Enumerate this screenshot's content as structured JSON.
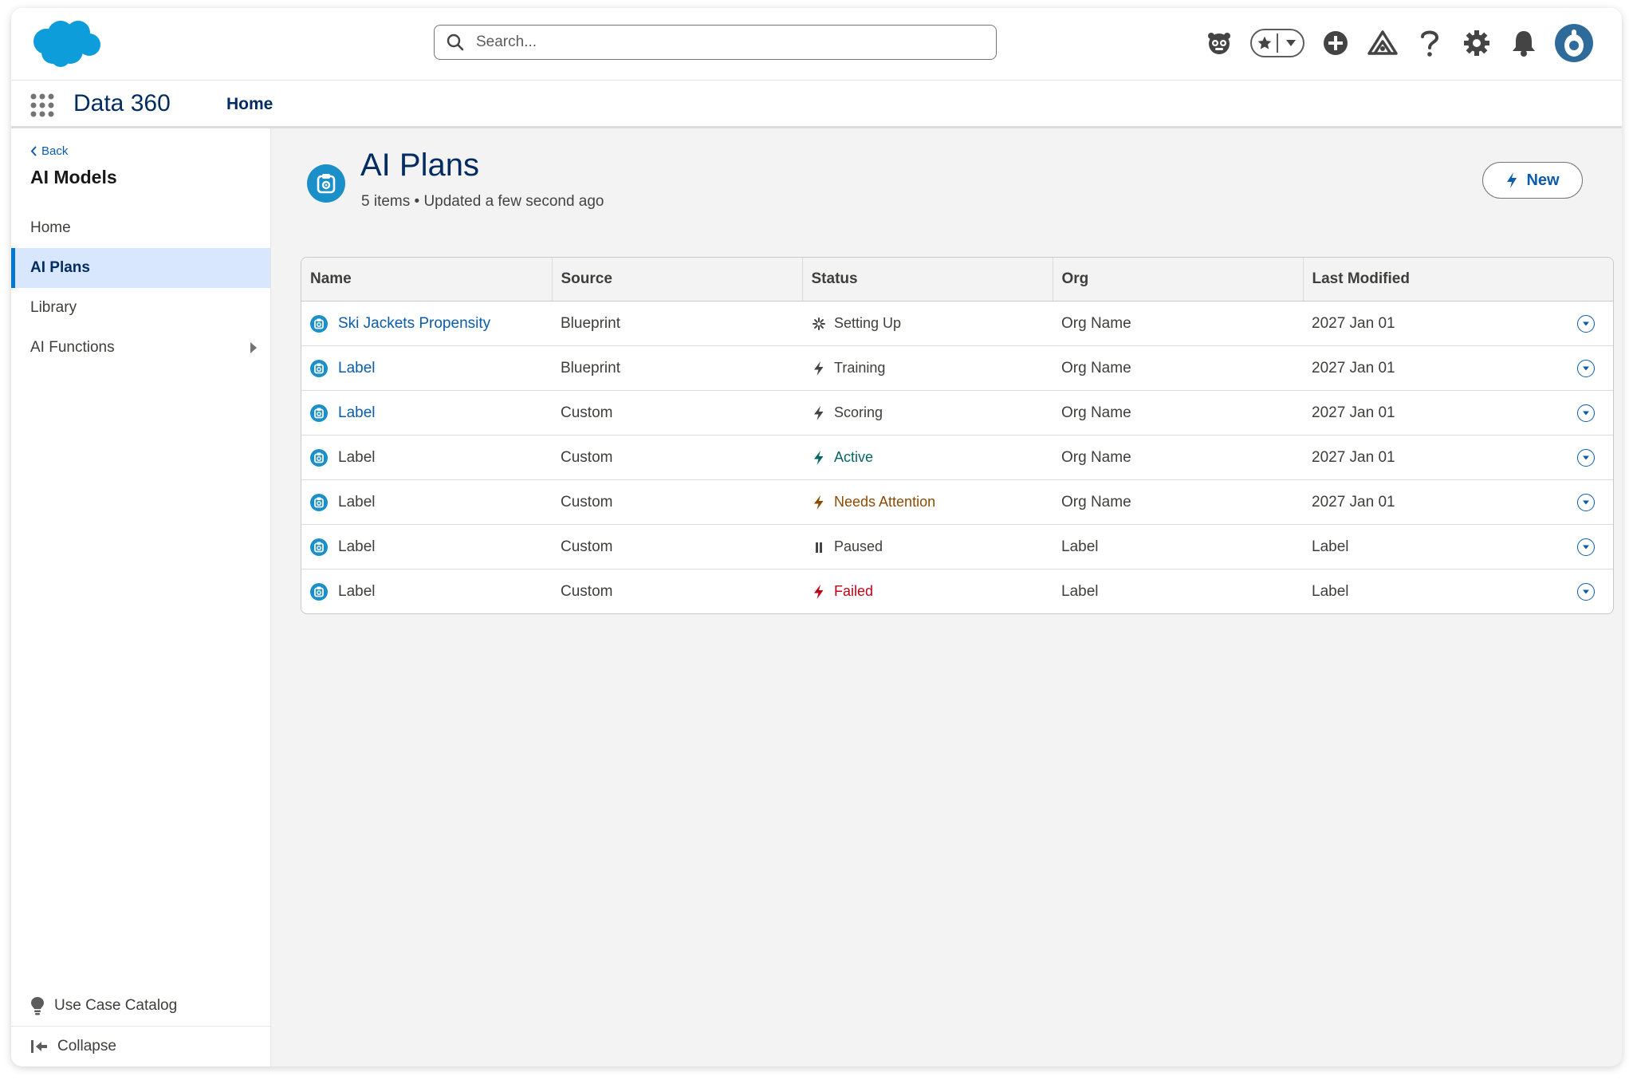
{
  "header": {
    "search_placeholder": "Search...",
    "icons": [
      "einstein-icon",
      "favorites-star-icon",
      "favorites-dropdown-icon",
      "global-add-icon",
      "trailhead-icon",
      "help-icon",
      "setup-gear-icon",
      "notifications-bell-icon",
      "user-avatar"
    ]
  },
  "context": {
    "app_name": "Data 360",
    "nav_item": "Home"
  },
  "sidebar": {
    "back_label": "Back",
    "title": "AI Models",
    "items": [
      {
        "label": "Home",
        "active": false
      },
      {
        "label": "AI Plans",
        "active": true
      },
      {
        "label": "Library",
        "active": false
      },
      {
        "label": "AI Functions",
        "active": false,
        "has_submenu": true
      }
    ],
    "footer": {
      "catalog_label": "Use Case Catalog",
      "collapse_label": "Collapse"
    }
  },
  "main": {
    "title": "AI Plans",
    "subtitle": "5 items • Updated a few second ago",
    "new_button": "New",
    "table": {
      "columns": [
        "Name",
        "Source",
        "Status",
        "Org",
        "Last Modified"
      ],
      "rows": [
        {
          "name": "Ski Jackets Propensity",
          "name_link": true,
          "source": "Blueprint",
          "status": "Setting Up",
          "status_icon": "spinner-icon",
          "status_tone": "default",
          "org": "Org Name",
          "modified": "2027 Jan 01"
        },
        {
          "name": "Label",
          "name_link": true,
          "source": "Blueprint",
          "status": "Training",
          "status_icon": "bolt-icon",
          "status_tone": "default",
          "org": "Org Name",
          "modified": "2027 Jan 01"
        },
        {
          "name": "Label",
          "name_link": true,
          "source": "Custom",
          "status": "Scoring",
          "status_icon": "bolt-icon",
          "status_tone": "default",
          "org": "Org Name",
          "modified": "2027 Jan 01"
        },
        {
          "name": "Label",
          "name_link": false,
          "source": "Custom",
          "status": "Active",
          "status_icon": "bolt-icon",
          "status_tone": "success",
          "org": "Org Name",
          "modified": "2027 Jan 01"
        },
        {
          "name": "Label",
          "name_link": false,
          "source": "Custom",
          "status": "Needs Attention",
          "status_icon": "bolt-icon",
          "status_tone": "warning",
          "org": "Org Name",
          "modified": "2027 Jan 01"
        },
        {
          "name": "Label",
          "name_link": false,
          "source": "Custom",
          "status": "Paused",
          "status_icon": "pause-icon",
          "status_tone": "default",
          "org": "Label",
          "modified": "Label"
        },
        {
          "name": "Label",
          "name_link": false,
          "source": "Custom",
          "status": "Failed",
          "status_icon": "bolt-icon",
          "status_tone": "error",
          "org": "Label",
          "modified": "Label"
        }
      ]
    }
  },
  "colors": {
    "brand": "#0176d3",
    "link": "#0b5cab",
    "nav_text": "#032d60",
    "icon_blue": "#1b8fc7",
    "active_bg": "#d8e6fe",
    "success": "#056764",
    "warning": "#8c4b02",
    "error": "#ba0517"
  }
}
